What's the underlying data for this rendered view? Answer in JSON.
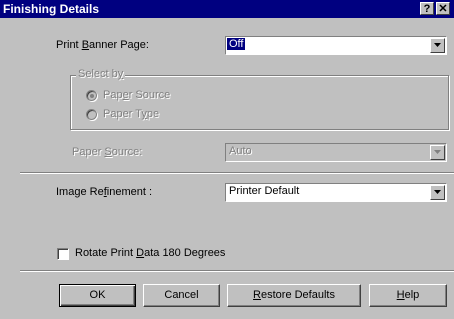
{
  "window": {
    "title": "Finishing Details",
    "help_glyph": "?",
    "close_glyph": "✕"
  },
  "banner": {
    "label_pre": "Print ",
    "label_key": "B",
    "label_post": "anner Page:",
    "value": "Off"
  },
  "select_by": {
    "legend_pre": "Select b",
    "legend_key": "y",
    "options": [
      {
        "pre": "Pap",
        "key": "e",
        "post": "r Source",
        "selected": true
      },
      {
        "pre": "Paper T",
        "key": "y",
        "post": "pe",
        "selected": false
      }
    ]
  },
  "paper_source": {
    "label_pre": "Paper ",
    "label_key": "S",
    "label_post": "ource:",
    "value": "Auto"
  },
  "refinement": {
    "label_pre": "Image Re",
    "label_key": "f",
    "label_post": "inement :",
    "value": "Printer Default"
  },
  "rotate": {
    "label_pre": "Rotate Print ",
    "label_key": "D",
    "label_post": "ata 180 Degrees",
    "checked": false
  },
  "buttons": {
    "ok": "OK",
    "cancel": "Cancel",
    "restore_key": "R",
    "restore_post": "estore Defaults",
    "help_key": "H",
    "help_post": "elp"
  }
}
